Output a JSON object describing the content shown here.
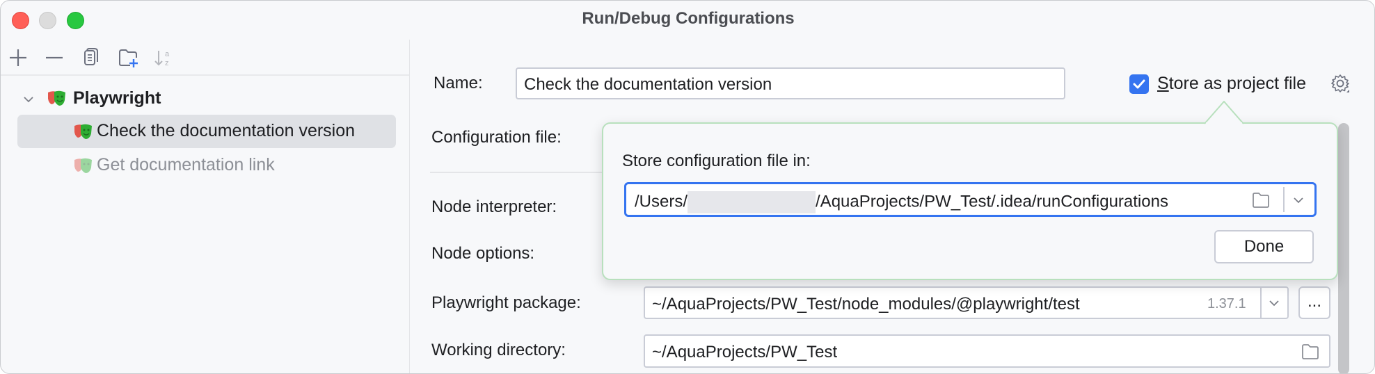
{
  "window": {
    "title": "Run/Debug Configurations",
    "traffic_lights": {
      "close": "#ff5f57",
      "minimize": "#dcdcdc",
      "maximize": "#28c840"
    }
  },
  "toolbar": {
    "items": [
      {
        "name": "add-icon",
        "tooltip": "Add"
      },
      {
        "name": "remove-icon",
        "tooltip": "Remove"
      },
      {
        "name": "copy-icon",
        "tooltip": "Copy"
      },
      {
        "name": "new-folder-icon",
        "tooltip": "New folder"
      },
      {
        "name": "sort-az-icon",
        "tooltip": "Sort"
      }
    ]
  },
  "tree": {
    "group": {
      "label": "Playwright",
      "expanded": true,
      "icon": "playwright-icon"
    },
    "items": [
      {
        "label": "Check the documentation version",
        "selected": true,
        "icon": "playwright-icon"
      },
      {
        "label": "Get documentation link",
        "selected": false,
        "dimmed": true,
        "icon": "playwright-icon"
      }
    ]
  },
  "form": {
    "name_label": "Name:",
    "name_value": "Check the documentation version",
    "store_as_project_file": {
      "label_prefix": "S",
      "label_rest": "tore as project file",
      "checked": true
    },
    "config_file_label": "Configuration file:",
    "node_interpreter_label": "Node interpreter:",
    "node_options_label": "Node options:",
    "playwright_package_label": "Playwright package:",
    "playwright_package_value": "~/AquaProjects/PW_Test/node_modules/@playwright/test",
    "playwright_package_version": "1.37.1",
    "more_button_label": "...",
    "working_directory_label": "Working directory:",
    "working_directory_value": "~/AquaProjects/PW_Test"
  },
  "popup": {
    "label": "Store configuration file in:",
    "path_prefix": "/Users/",
    "path_suffix": "/AquaProjects/PW_Test/.idea/runConfigurations",
    "done_label": "Done"
  },
  "colors": {
    "accent": "#3574f0",
    "popup_border": "#b8e0bd",
    "background": "#f7f8fa"
  }
}
